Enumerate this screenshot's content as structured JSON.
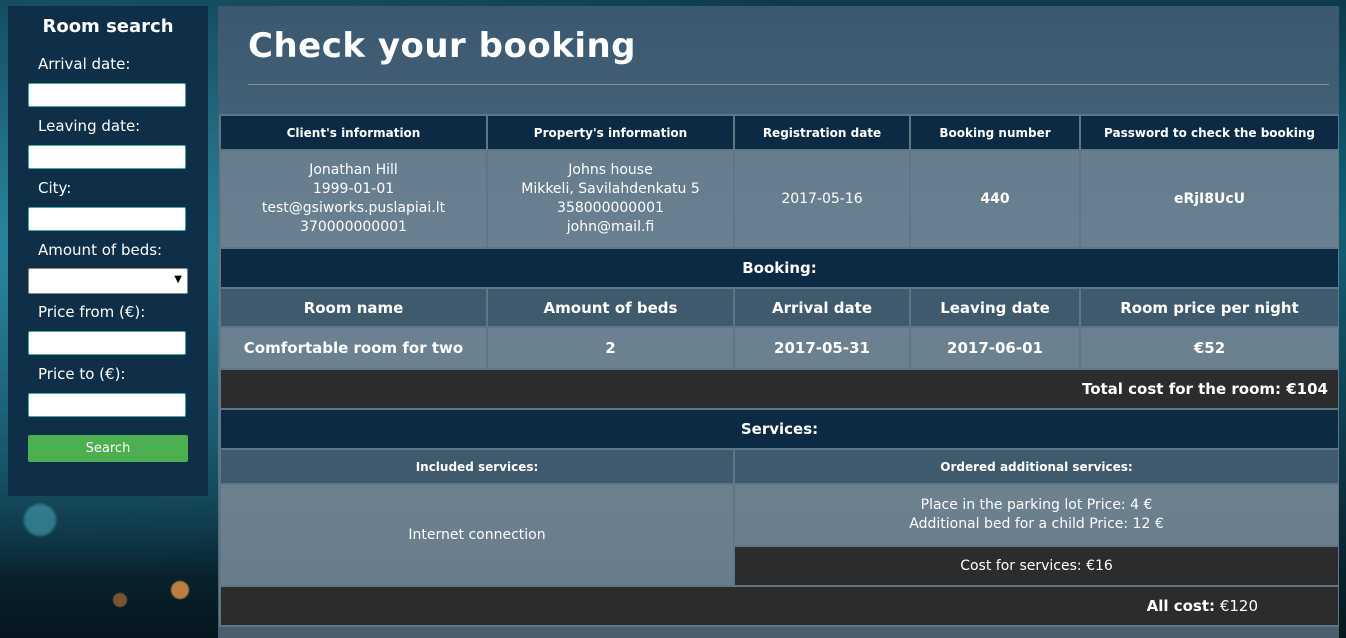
{
  "sidebar": {
    "title": "Room search",
    "arrival_label": "Arrival date:",
    "leaving_label": "Leaving date:",
    "city_label": "City:",
    "beds_label": "Amount of beds:",
    "price_from_label": "Price from (€):",
    "price_to_label": "Price to (€):",
    "search_button": "Search"
  },
  "page": {
    "title": "Check your booking"
  },
  "info_headers": [
    "Client's information",
    "Property's information",
    "Registration date",
    "Booking number",
    "Password to check the booking"
  ],
  "client": {
    "name": "Jonathan Hill",
    "birth": "1999-01-01",
    "email": "test@gsiworks.puslapiai.lt",
    "phone": "370000000001"
  },
  "property": {
    "name": "Johns house",
    "address": "Mikkeli, Savilahdenkatu 5",
    "phone": "358000000001",
    "email": "john@mail.fi"
  },
  "registration_date": "2017-05-16",
  "booking_number": "440",
  "password": "eRjI8UcU",
  "booking_section": "Booking:",
  "room_headers": [
    "Room name",
    "Amount of beds",
    "Arrival date",
    "Leaving date",
    "Room price per night"
  ],
  "room": {
    "name": "Comfortable room for two",
    "beds": "2",
    "arrival": "2017-05-31",
    "leaving": "2017-06-01",
    "price": "€52"
  },
  "room_total": "Total cost for the room: €104",
  "services_section": "Services:",
  "services_headers": {
    "included": "Included services:",
    "ordered": "Ordered additional services:"
  },
  "included_services": "Internet connection",
  "ordered_services": [
    "Place in the parking lot Price: 4 €",
    "Additional bed for a child Price: 12 €"
  ],
  "services_cost": "Cost for services: €16",
  "all_cost_label": "All cost:",
  "all_cost_value": "€120"
}
